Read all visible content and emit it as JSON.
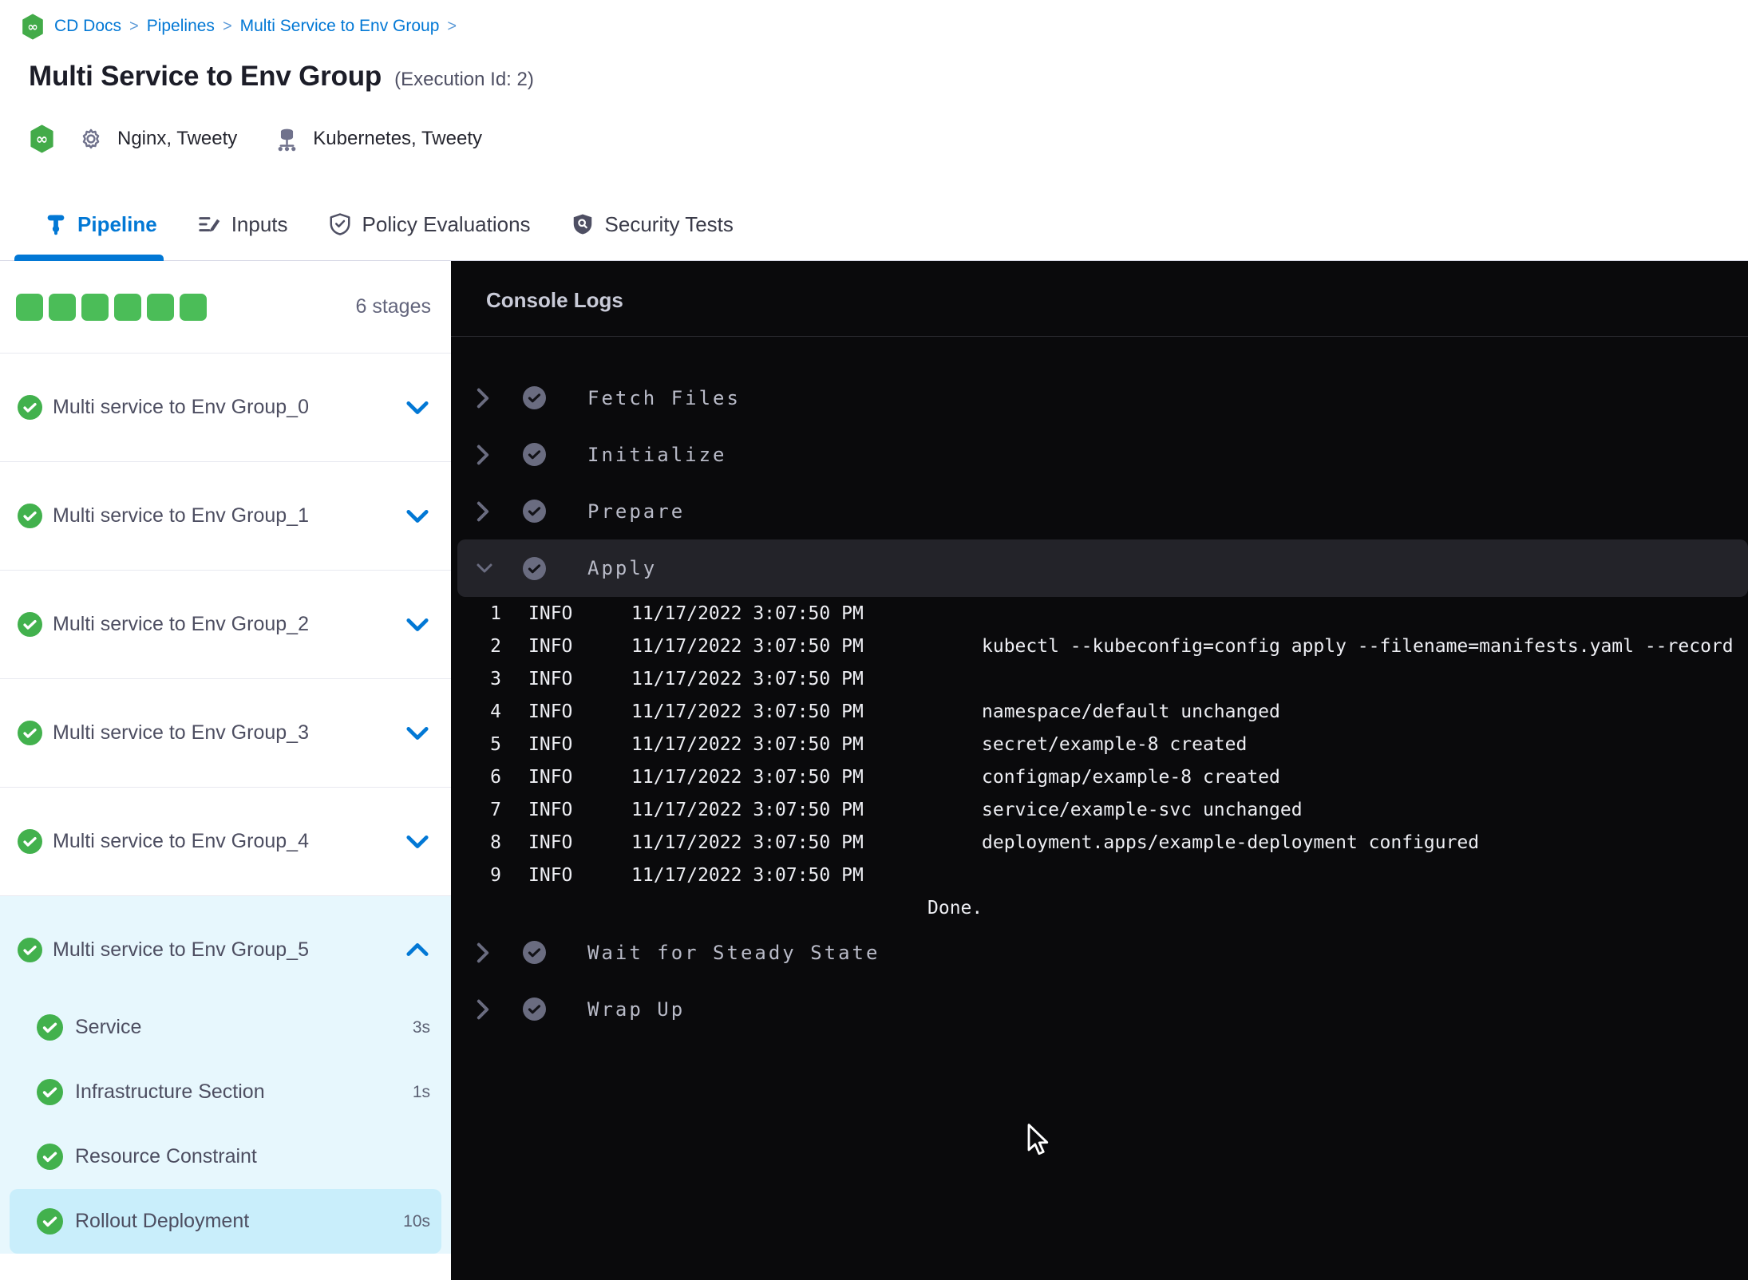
{
  "colors": {
    "accent_blue": "#0278d5",
    "success_green": "#42b14d",
    "stage_square_green": "#4bbd58",
    "console_bg": "#0a0a0c",
    "expanded_stage_bg": "#e7f7fd",
    "selected_step_bg": "#c9eefb",
    "console_step_icon_gray": "#6a6c80"
  },
  "breadcrumb": {
    "icon": "harness-cd-icon",
    "items": [
      "CD Docs",
      "Pipelines",
      "Multi Service to Env Group"
    ]
  },
  "header": {
    "title": "Multi Service to Env Group",
    "execution_id": "(Execution Id: 2)",
    "services_label": "Nginx, Tweety",
    "environments_label": "Kubernetes, Tweety"
  },
  "tabs": [
    {
      "label": "Pipeline",
      "icon": "pipeline-icon",
      "active": true
    },
    {
      "label": "Inputs",
      "icon": "inputs-icon",
      "active": false
    },
    {
      "label": "Policy Evaluations",
      "icon": "shield-check-icon",
      "active": false
    },
    {
      "label": "Security Tests",
      "icon": "shield-search-icon",
      "active": false
    }
  ],
  "sidebar": {
    "stage_count_label": "6 stages",
    "stages": [
      {
        "label": "Multi service to Env Group_0",
        "status": "success"
      },
      {
        "label": "Multi service to Env Group_1",
        "status": "success"
      },
      {
        "label": "Multi service to Env Group_2",
        "status": "success"
      },
      {
        "label": "Multi service to Env Group_3",
        "status": "success"
      },
      {
        "label": "Multi service to Env Group_4",
        "status": "success"
      }
    ],
    "expanded_stage": {
      "label": "Multi service to Env Group_5",
      "status": "success",
      "substeps": [
        {
          "label": "Service",
          "duration": "3s"
        },
        {
          "label": "Infrastructure Section",
          "duration": "1s"
        },
        {
          "label": "Resource Constraint",
          "duration": ""
        },
        {
          "label": "Rollout Deployment",
          "duration": "10s",
          "selected": true
        }
      ]
    }
  },
  "console": {
    "title": "Console Logs",
    "steps_before": [
      "Fetch Files",
      "Initialize",
      "Prepare"
    ],
    "expanded_step": "Apply",
    "logs": [
      {
        "num": "1",
        "level": "INFO",
        "time": "11/17/2022 3:07:50 PM",
        "msg": ""
      },
      {
        "num": "2",
        "level": "INFO",
        "time": "11/17/2022 3:07:50 PM",
        "msg": "kubectl --kubeconfig=config apply --filename=manifests.yaml --record"
      },
      {
        "num": "3",
        "level": "INFO",
        "time": "11/17/2022 3:07:50 PM",
        "msg": ""
      },
      {
        "num": "4",
        "level": "INFO",
        "time": "11/17/2022 3:07:50 PM",
        "msg": "namespace/default unchanged"
      },
      {
        "num": "5",
        "level": "INFO",
        "time": "11/17/2022 3:07:50 PM",
        "msg": "secret/example-8 created"
      },
      {
        "num": "6",
        "level": "INFO",
        "time": "11/17/2022 3:07:50 PM",
        "msg": "configmap/example-8 created"
      },
      {
        "num": "7",
        "level": "INFO",
        "time": "11/17/2022 3:07:50 PM",
        "msg": "service/example-svc unchanged"
      },
      {
        "num": "8",
        "level": "INFO",
        "time": "11/17/2022 3:07:50 PM",
        "msg": "deployment.apps/example-deployment configured"
      },
      {
        "num": "9",
        "level": "INFO",
        "time": "11/17/2022 3:07:50 PM",
        "msg": ""
      }
    ],
    "done_text": "Done.",
    "steps_after": [
      "Wait for Steady State",
      "Wrap Up"
    ]
  }
}
